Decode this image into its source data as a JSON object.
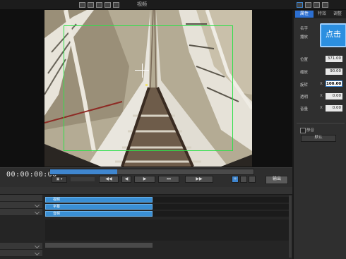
{
  "topbar": {
    "menu_label": "视频"
  },
  "transport": {
    "timecode": "00:00:00:00",
    "scrub_progress": 0.33,
    "buttons": [
      "◀◀",
      "◀",
      "▶",
      "⏭",
      "▶▶",
      "+"
    ],
    "output_label": "输出"
  },
  "timeline": {
    "clips": [
      {
        "label": "视频"
      },
      {
        "label": "字幕"
      },
      {
        "label": "音频"
      }
    ]
  },
  "right_panel": {
    "tabs": [
      "属性",
      "特效",
      "调整"
    ],
    "click_button": "点击",
    "fields": [
      {
        "label": "位置",
        "sub": "X",
        "value": "371.00"
      },
      {
        "label": "缩放",
        "sub": "X",
        "value": "90.00"
      },
      {
        "label": "旋转",
        "sub": "X",
        "value": "100.00",
        "active": true
      },
      {
        "label": "透明",
        "sub": "X",
        "value": "0.00"
      },
      {
        "label": "音量",
        "sub": "X",
        "value": "0.00"
      }
    ],
    "top_labels": [
      "名字",
      "播放"
    ],
    "checkbox_label": "静音",
    "select_value": "默认"
  },
  "colors": {
    "accent": "#3f86cf",
    "safe_frame": "#2ee04a",
    "button": "#2c8fe0"
  }
}
